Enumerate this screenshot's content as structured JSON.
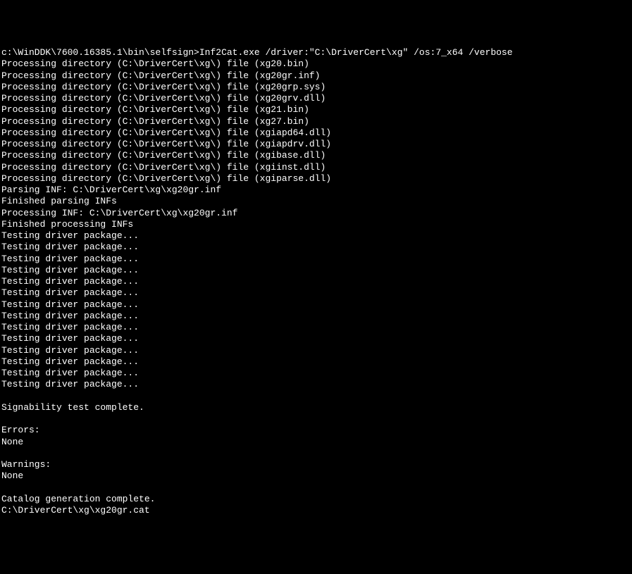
{
  "terminal": {
    "prompt": "c:\\WinDDK\\7600.16385.1\\bin\\selfsign>",
    "command": "Inf2Cat.exe /driver:\"C:\\DriverCert\\xg\" /os:7_x64 /verbose",
    "processing_dir": "Processing directory (C:\\DriverCert\\xg\\) file",
    "files": [
      "(xg20.bin)",
      "(xg20gr.inf)",
      "(xg20grp.sys)",
      "(xg20grv.dll)",
      "(xg21.bin)",
      "(xg27.bin)",
      "(xgiapd64.dll)",
      "(xgiapdrv.dll)",
      "(xgibase.dll)",
      "(xgiinst.dll)",
      "(xgiparse.dll)"
    ],
    "parsing_inf": "Parsing INF: C:\\DriverCert\\xg\\xg20gr.inf",
    "finished_parsing": "Finished parsing INFs",
    "processing_inf": "Processing INF: C:\\DriverCert\\xg\\xg20gr.inf",
    "finished_processing": "Finished processing INFs",
    "testing_line": "Testing driver package...",
    "testing_count": 14,
    "signability_complete": "Signability test complete.",
    "errors_label": "Errors:",
    "errors_value": "None",
    "warnings_label": "Warnings:",
    "warnings_value": "None",
    "catalog_complete": "Catalog generation complete.",
    "catalog_path": "C:\\DriverCert\\xg\\xg20gr.cat"
  }
}
